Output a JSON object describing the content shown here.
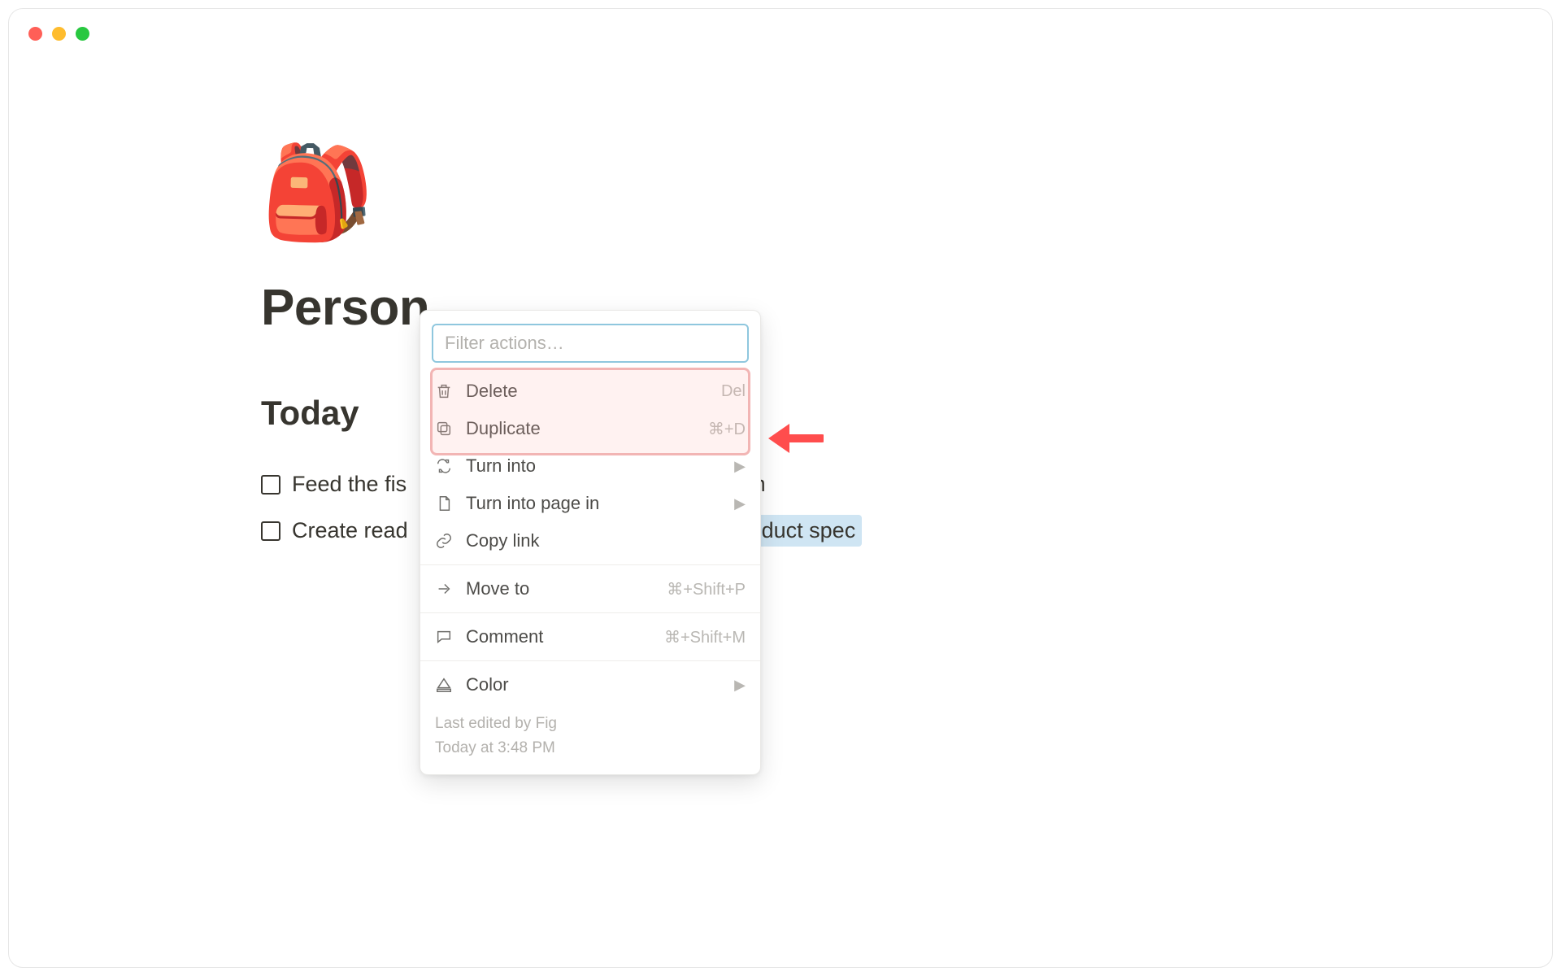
{
  "page": {
    "icon": "🎒",
    "title": "Person",
    "section_heading": "Today"
  },
  "todos": {
    "col1": [
      {
        "label": "Feed the fis"
      },
      {
        "label": "Create read"
      }
    ],
    "col2": [
      {
        "label": "Call mom",
        "selected": false
      },
      {
        "label": "Write product spec",
        "selected": true
      }
    ]
  },
  "context_menu": {
    "filter_placeholder": "Filter actions…",
    "items": [
      {
        "id": "delete",
        "label": "Delete",
        "shortcut": "Del",
        "icon": "trash"
      },
      {
        "id": "duplicate",
        "label": "Duplicate",
        "shortcut": "⌘+D",
        "icon": "duplicate"
      },
      {
        "id": "turn_into",
        "label": "Turn into",
        "submenu": true,
        "icon": "loop"
      },
      {
        "id": "turn_into_page",
        "label": "Turn into page in",
        "submenu": true,
        "icon": "page"
      },
      {
        "id": "copy_link",
        "label": "Copy link",
        "icon": "link"
      },
      {
        "divider": true
      },
      {
        "id": "move_to",
        "label": "Move to",
        "shortcut": "⌘+Shift+P",
        "icon": "moveto"
      },
      {
        "divider": true
      },
      {
        "id": "comment",
        "label": "Comment",
        "shortcut": "⌘+Shift+M",
        "icon": "comment"
      },
      {
        "divider": true
      },
      {
        "id": "color",
        "label": "Color",
        "submenu": true,
        "icon": "color"
      }
    ],
    "footer_line1": "Last edited by Fig",
    "footer_line2": "Today at 3:48 PM",
    "highlighted_ids": [
      "delete",
      "duplicate"
    ]
  }
}
